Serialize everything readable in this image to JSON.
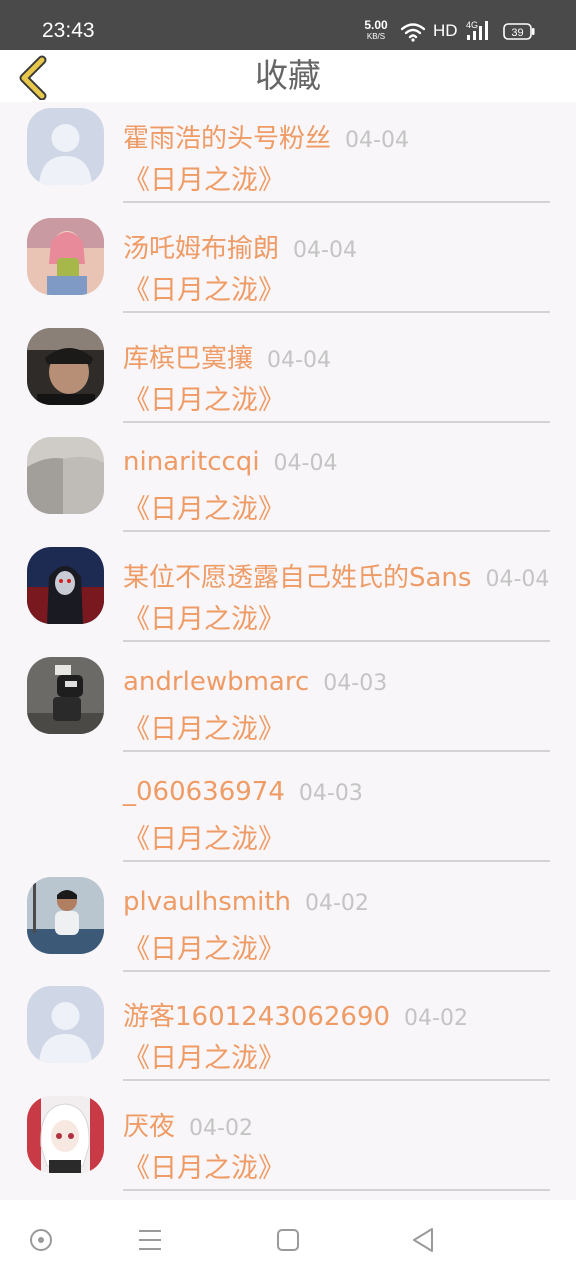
{
  "status": {
    "time": "23:43",
    "net_speed": "5.00",
    "net_unit": "KB/S",
    "hd": "HD",
    "network": "4G",
    "battery": "39"
  },
  "header": {
    "title": "收藏"
  },
  "items": [
    {
      "name": "霍雨浩的头号粉丝",
      "date": "04-04",
      "work": "《日月之泷》",
      "avatar": "default-avatar"
    },
    {
      "name": "汤吒姆布揄朗",
      "date": "04-04",
      "work": "《日月之泷》",
      "avatar": "anime-girl-avatar"
    },
    {
      "name": "库槟巴寞攘",
      "date": "04-04",
      "work": "《日月之泷》",
      "avatar": "smoking-man-avatar"
    },
    {
      "name": "ninaritccqi",
      "date": "04-04",
      "work": "《日月之泷》",
      "avatar": "gray-shirt-avatar"
    },
    {
      "name": "某位不愿透露自己姓氏的Sans",
      "date": "04-04",
      "work": "《日月之泷》",
      "avatar": "hooded-figure-avatar"
    },
    {
      "name": "andrlewbmarc",
      "date": "04-03",
      "work": "《日月之泷》",
      "avatar": "crouching-person-avatar"
    },
    {
      "name": "_060636974",
      "date": "04-03",
      "work": "《日月之泷》",
      "avatar": ""
    },
    {
      "name": "plvaulhsmith",
      "date": "04-02",
      "work": "《日月之泷》",
      "avatar": "outdoor-man-avatar"
    },
    {
      "name": "游客1601243062690",
      "date": "04-02",
      "work": "《日月之泷》",
      "avatar": "default-avatar"
    },
    {
      "name": "厌夜",
      "date": "04-02",
      "work": "《日月之泷》",
      "avatar": "white-hair-anime-avatar"
    }
  ],
  "colors": {
    "accent": "#ef9b66",
    "back_arrow": "#e8c84a",
    "muted": "#c4c4c4"
  }
}
